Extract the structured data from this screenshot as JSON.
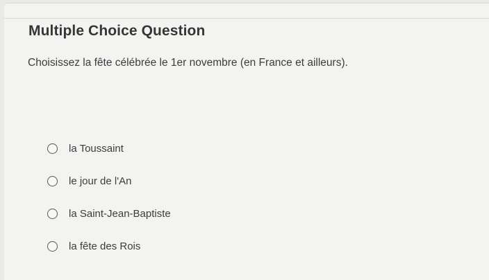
{
  "question": {
    "heading": "Multiple Choice Question",
    "prompt": "Choisissez la fête célébrée le 1er novembre (en France et ailleurs).",
    "options": [
      {
        "label": "la Toussaint"
      },
      {
        "label": "le jour de l'An"
      },
      {
        "label": "la Saint-Jean-Baptiste"
      },
      {
        "label": "la fête des Rois"
      }
    ]
  }
}
